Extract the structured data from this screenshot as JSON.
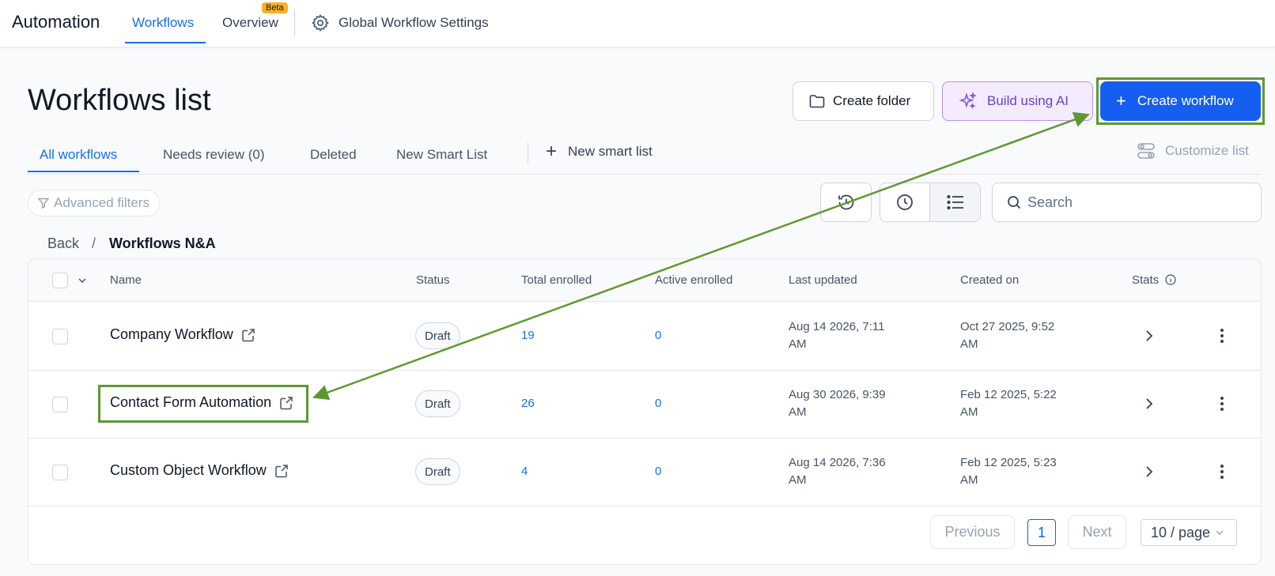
{
  "nav": {
    "app_title": "Automation",
    "tabs": [
      {
        "label": "Workflows"
      },
      {
        "label": "Overview",
        "badge": "Beta"
      },
      {
        "label": "Global Workflow Settings",
        "icon": "gear-icon"
      }
    ]
  },
  "header": {
    "title": "Workflows list",
    "create_folder_label": "Create folder",
    "build_ai_label": "Build using AI",
    "create_workflow_label": "Create workflow"
  },
  "list_tabs": {
    "all": "All workflows",
    "needs_review": "Needs review (0)",
    "deleted": "Deleted",
    "new_smart_list": "New Smart List",
    "add_smart_list": "New smart list",
    "customize": "Customize list"
  },
  "filters": {
    "advanced_label": "Advanced filters",
    "search_placeholder": "Search"
  },
  "breadcrumb": {
    "back": "Back",
    "separator": "/",
    "current": "Workflows N&A"
  },
  "table": {
    "columns": {
      "name": "Name",
      "status": "Status",
      "total_enrolled": "Total enrolled",
      "active_enrolled": "Active enrolled",
      "last_updated": "Last updated",
      "created_on": "Created on",
      "stats": "Stats"
    },
    "rows": [
      {
        "name": "Company Workflow",
        "status": "Draft",
        "total": "19",
        "active": "0",
        "updated_1": "Aug 14 2026, 7:11",
        "updated_2": "AM",
        "created_1": "Oct 27 2025, 9:52",
        "created_2": "AM"
      },
      {
        "name": "Contact Form Automation",
        "status": "Draft",
        "total": "26",
        "active": "0",
        "updated_1": "Aug 30 2026, 9:39",
        "updated_2": "AM",
        "created_1": "Feb 12 2025, 5:22",
        "created_2": "AM"
      },
      {
        "name": "Custom Object Workflow",
        "status": "Draft",
        "total": "4",
        "active": "0",
        "updated_1": "Aug 14 2026, 7:36",
        "updated_2": "AM",
        "created_1": "Feb 12 2025, 5:23",
        "created_2": "AM"
      }
    ]
  },
  "pagination": {
    "previous": "Previous",
    "current_page": "1",
    "next": "Next",
    "per_page": "10 / page"
  },
  "colors": {
    "accent": "#1570ef",
    "primary_button": "#155eef",
    "ai_purple": "#6941c6",
    "annotation_green": "#5c9a2e"
  }
}
